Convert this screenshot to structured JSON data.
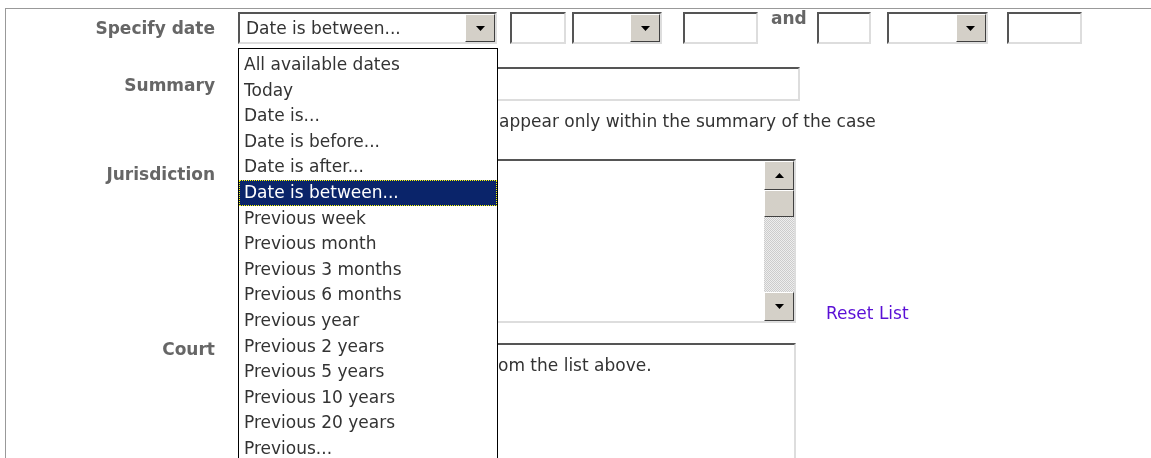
{
  "specify_date": {
    "label": "Specify date",
    "select_value": "Date is between...",
    "connector": "and"
  },
  "summary": {
    "label": "Summary",
    "hint": "appear only within the summary of the case"
  },
  "jurisdiction": {
    "label": "Jurisdiction",
    "link": "Reset List"
  },
  "court": {
    "label": "Court",
    "text": "om the list above."
  },
  "date_options": [
    {
      "label": "All available dates",
      "selected": false
    },
    {
      "label": "Today",
      "selected": false
    },
    {
      "label": "Date is...",
      "selected": false
    },
    {
      "label": "Date is before...",
      "selected": false
    },
    {
      "label": "Date is after...",
      "selected": false
    },
    {
      "label": "Date is between...",
      "selected": true
    },
    {
      "label": "Previous week",
      "selected": false
    },
    {
      "label": "Previous month",
      "selected": false
    },
    {
      "label": "Previous 3 months",
      "selected": false
    },
    {
      "label": "Previous 6 months",
      "selected": false
    },
    {
      "label": "Previous year",
      "selected": false
    },
    {
      "label": "Previous 2 years",
      "selected": false
    },
    {
      "label": "Previous 5 years",
      "selected": false
    },
    {
      "label": "Previous 10 years",
      "selected": false
    },
    {
      "label": "Previous 20 years",
      "selected": false
    },
    {
      "label": "Previous...",
      "selected": false
    }
  ]
}
